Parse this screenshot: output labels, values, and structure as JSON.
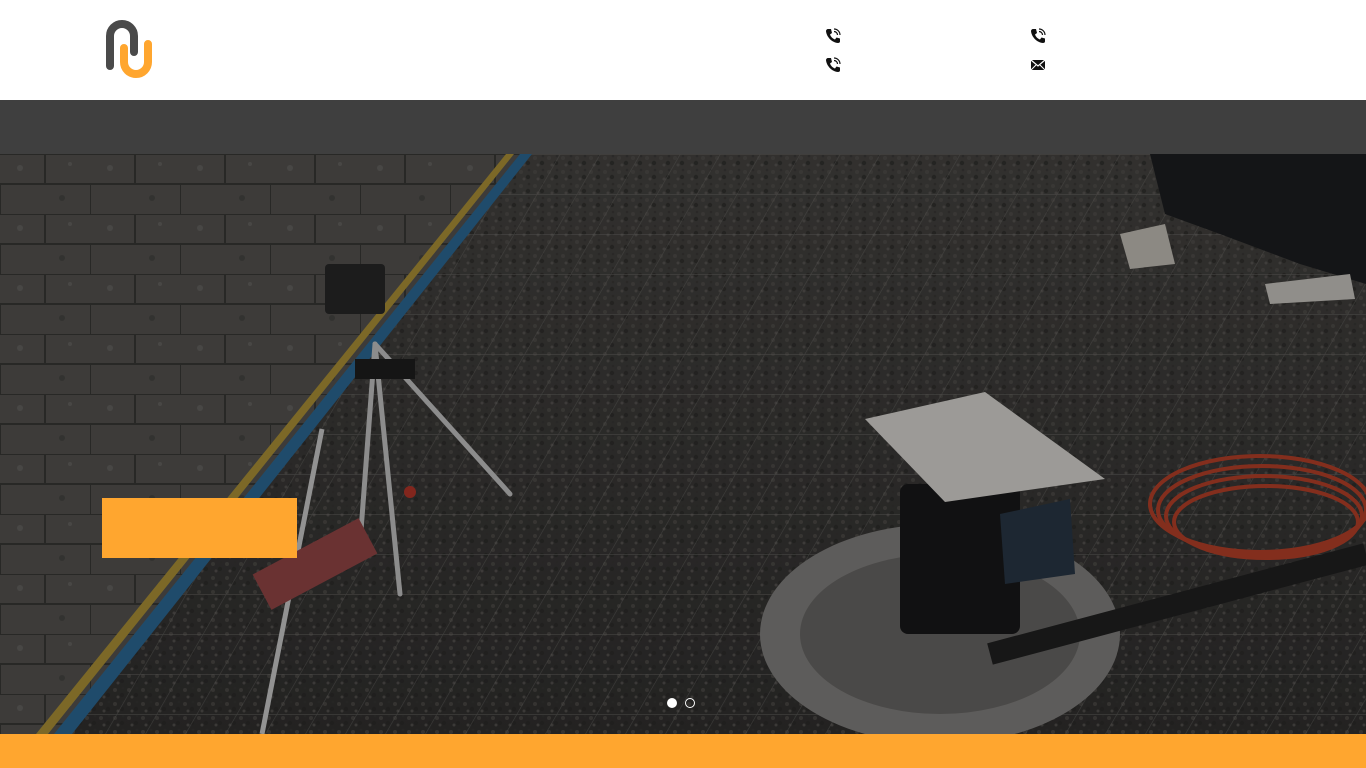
{
  "brand": {
    "logo_icon": "nu-logo-icon",
    "colors": {
      "orange": "#ffa62f",
      "charcoal": "#4a4a4a"
    }
  },
  "header": {
    "contacts": [
      {
        "icon": "phone-icon",
        "text": ""
      },
      {
        "icon": "phone-icon",
        "text": ""
      },
      {
        "icon": "phone-icon",
        "text": ""
      },
      {
        "icon": "mail-icon",
        "text": ""
      }
    ]
  },
  "navbar": {
    "color": "#3f3f3f"
  },
  "hero": {
    "cta_label": "",
    "slides": [
      {
        "active": true
      },
      {
        "active": false
      }
    ]
  },
  "footer_band": {
    "color": "#ffa62f"
  }
}
